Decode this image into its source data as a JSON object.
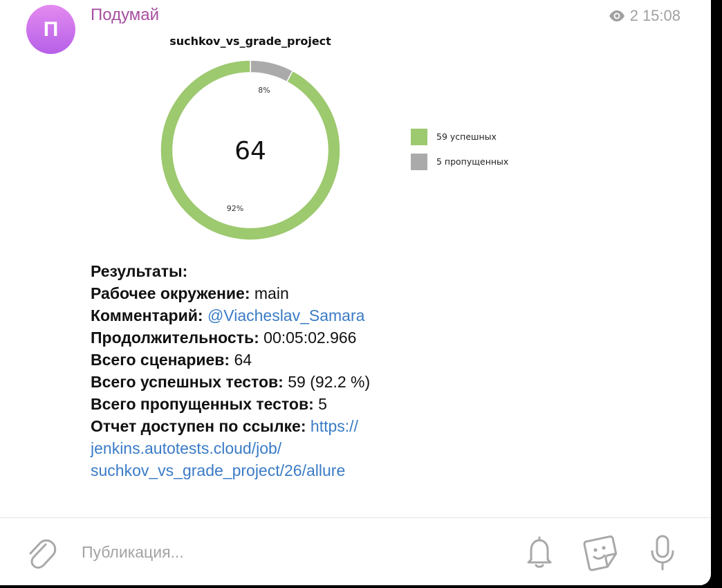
{
  "message": {
    "avatar_letter": "П",
    "sender": "Подумай",
    "views": "2",
    "time": "15:08"
  },
  "chart_data": {
    "type": "pie",
    "title": "suchkov_vs_grade_project",
    "center_label": "64",
    "slices": [
      {
        "name": "59 успешных",
        "value": 59,
        "percent_label": "92%",
        "color": "#9dc96f"
      },
      {
        "name": "5 пропущенных",
        "value": 5,
        "percent_label": "8%",
        "color": "#aaaaaa"
      }
    ]
  },
  "results": {
    "heading": "Результаты:",
    "env_label": "Рабочее окружение:",
    "env_value": "main",
    "comment_label": "Комментарий:",
    "comment_value": "@Viacheslav_Samara",
    "duration_label": "Продолжительность:",
    "duration_value": "00:05:02.966",
    "scenarios_label": "Всего сценариев:",
    "scenarios_value": "64",
    "passed_label": "Всего успешных тестов:",
    "passed_value": "59 (92.2 %)",
    "skipped_label": "Всего пропущенных тестов:",
    "skipped_value": "5",
    "report_label": "Отчет доступен по ссылке:",
    "report_url": "https://jenkins.autotests.cloud/job/suchkov_vs_grade_project/26/allure"
  },
  "composer": {
    "placeholder": "Публикация..."
  }
}
